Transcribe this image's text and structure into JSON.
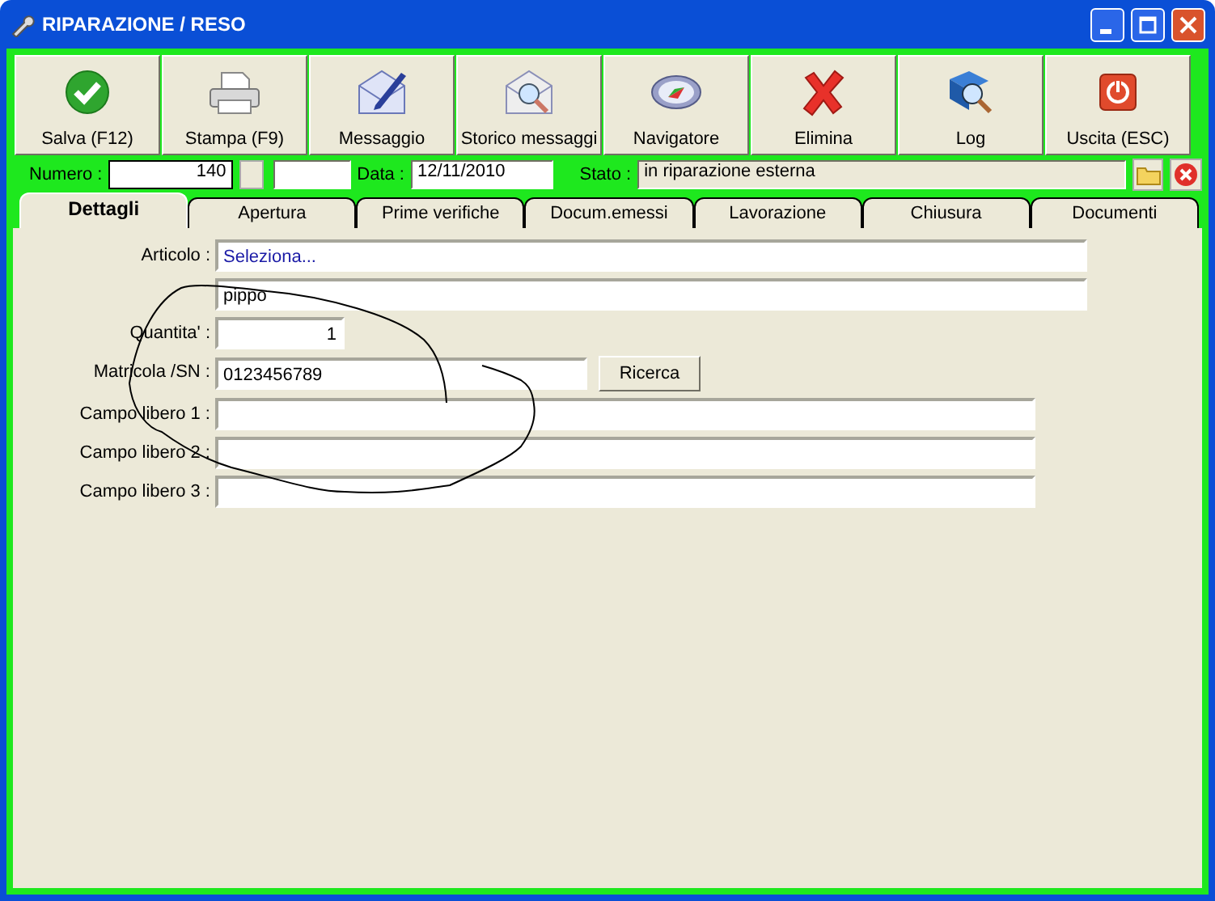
{
  "window": {
    "title": "RIPARAZIONE / RESO"
  },
  "toolbar": [
    {
      "label": "Salva (F12)",
      "kind": "save"
    },
    {
      "label": "Stampa (F9)",
      "kind": "print"
    },
    {
      "label": "Messaggio",
      "kind": "message"
    },
    {
      "label": "Storico messaggi",
      "kind": "history"
    },
    {
      "label": "Navigatore",
      "kind": "navigator"
    },
    {
      "label": "Elimina",
      "kind": "delete"
    },
    {
      "label": "Log",
      "kind": "log"
    },
    {
      "label": "Uscita (ESC)",
      "kind": "exit"
    }
  ],
  "header": {
    "numero_label": "Numero :",
    "numero": "140",
    "data_label": "Data :",
    "data": "12/11/2010",
    "stato_label": "Stato :",
    "stato": "in riparazione esterna"
  },
  "tabs": [
    {
      "label": "Dettagli",
      "selected": true
    },
    {
      "label": "Apertura",
      "selected": false
    },
    {
      "label": "Prime verifiche",
      "selected": false
    },
    {
      "label": "Docum.emessi",
      "selected": false
    },
    {
      "label": "Lavorazione",
      "selected": false
    },
    {
      "label": "Chiusura",
      "selected": false
    },
    {
      "label": "Documenti",
      "selected": false
    }
  ],
  "fields": [
    {
      "kind": "select",
      "label": "Articolo :",
      "value": "Seleziona..."
    },
    {
      "kind": "text",
      "value": "pippo"
    },
    {
      "kind": "quantity",
      "label": "Quantita' :",
      "value": "1"
    },
    {
      "kind": "serial",
      "label": "Matricola /SN :",
      "value": "0123456789",
      "button": "Ricerca"
    },
    {
      "kind": "free",
      "label": "Campo libero 1 :"
    },
    {
      "kind": "free",
      "label": "Campo libero 2 :"
    },
    {
      "kind": "free",
      "label": "Campo libero 3 :"
    }
  ]
}
